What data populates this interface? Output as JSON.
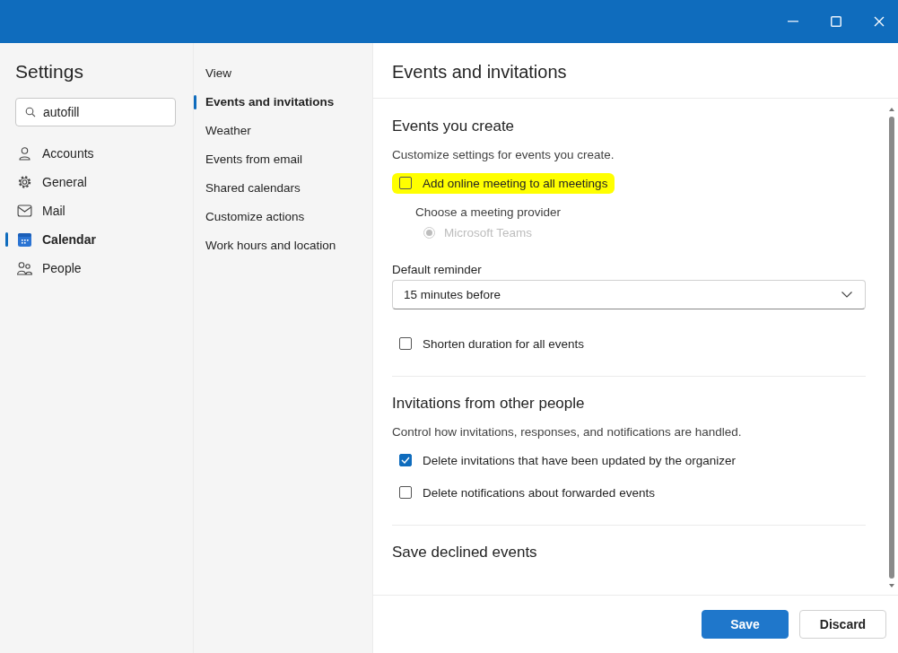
{
  "sidebar": {
    "title": "Settings",
    "search": {
      "value": "autofill"
    },
    "items": [
      {
        "label": "Accounts",
        "selected": false
      },
      {
        "label": "General",
        "selected": false
      },
      {
        "label": "Mail",
        "selected": false
      },
      {
        "label": "Calendar",
        "selected": true
      },
      {
        "label": "People",
        "selected": false
      }
    ]
  },
  "subnav": [
    {
      "label": "View",
      "selected": false
    },
    {
      "label": "Events and invitations",
      "selected": true
    },
    {
      "label": "Weather",
      "selected": false
    },
    {
      "label": "Events from email",
      "selected": false
    },
    {
      "label": "Shared calendars",
      "selected": false
    },
    {
      "label": "Customize actions",
      "selected": false
    },
    {
      "label": "Work hours and location",
      "selected": false
    }
  ],
  "panel": {
    "title": "Events and invitations",
    "sections": [
      {
        "heading": "Events you create",
        "description": "Customize settings for events you create.",
        "items": [
          {
            "kind": "checkbox",
            "label": "Add online meeting to all meetings",
            "checked": false,
            "highlighted": true
          },
          {
            "kind": "label",
            "text": "Choose a meeting provider"
          },
          {
            "kind": "radio",
            "label": "Microsoft Teams",
            "selected": true,
            "disabled": true
          },
          {
            "kind": "dropdown",
            "label": "Default reminder",
            "value": "15 minutes before"
          },
          {
            "kind": "checkbox",
            "label": "Shorten duration for all events",
            "checked": false,
            "highlighted": false
          }
        ]
      },
      {
        "heading": "Invitations from other people",
        "description": "Control how invitations, responses, and notifications are handled.",
        "items": [
          {
            "kind": "checkbox",
            "label": "Delete invitations that have been updated by the organizer",
            "checked": true,
            "highlighted": false
          },
          {
            "kind": "checkbox",
            "label": "Delete notifications about forwarded events",
            "checked": false,
            "highlighted": false
          }
        ]
      },
      {
        "heading": "Save declined events"
      }
    ]
  },
  "footer": {
    "buttons": [
      {
        "label": "Save",
        "kind": "primary"
      },
      {
        "label": "Discard",
        "kind": "secondary"
      }
    ]
  }
}
